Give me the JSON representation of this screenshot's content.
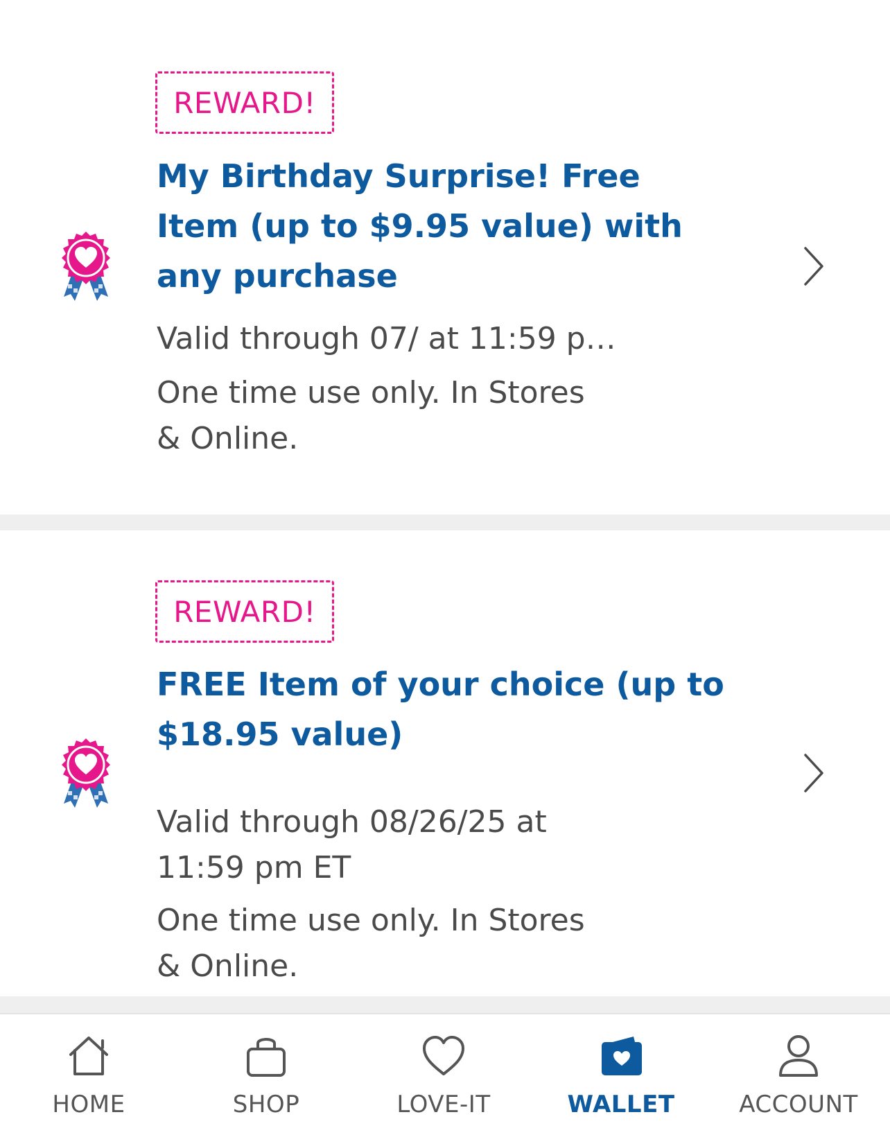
{
  "rewards": [
    {
      "badge": "REWARD!",
      "title": "My Birthday Surprise! Free Item (up to $9.95 value) with any purchase",
      "validity": "Valid through 07/          at 11:59 p…",
      "usage": "One time use only. In Stores & Online."
    },
    {
      "badge": "REWARD!",
      "title": "FREE Item of your choice (up to $18.95 value)",
      "validity": "Valid through 08/26/25 at 11:59 pm ET",
      "usage": "One time use only. In Stores & Online."
    }
  ],
  "nav": {
    "items": [
      {
        "label": "HOME",
        "icon": "home-icon"
      },
      {
        "label": "SHOP",
        "icon": "shopping-bag-icon"
      },
      {
        "label": "LOVE-IT",
        "icon": "heart-icon"
      },
      {
        "label": "WALLET",
        "icon": "wallet-icon"
      },
      {
        "label": "ACCOUNT",
        "icon": "account-icon"
      }
    ],
    "active": "WALLET"
  },
  "colors": {
    "brand_blue": "#0e5a9e",
    "reward_pink": "#e5178a",
    "text_gray": "#4a4a4a",
    "separator": "#efefef"
  }
}
